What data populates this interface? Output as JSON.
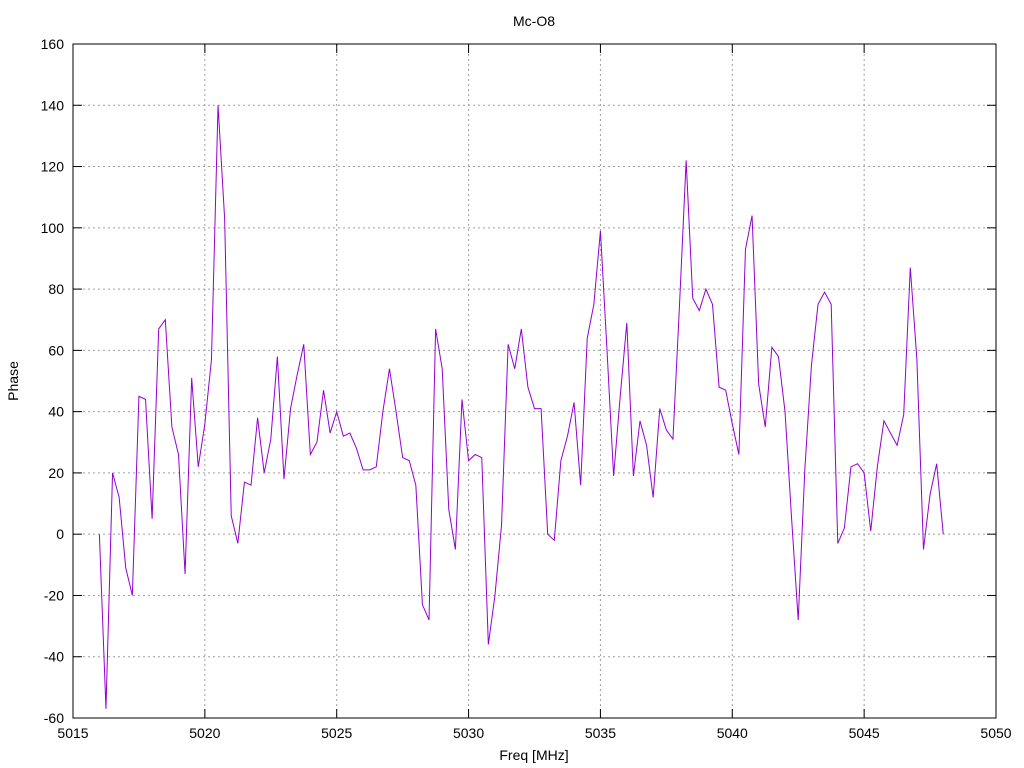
{
  "chart_data": {
    "type": "line",
    "title": "Mc-O8",
    "xlabel": "Freq [MHz]",
    "ylabel": "Phase",
    "xlim": [
      5015,
      5050
    ],
    "ylim": [
      -60,
      160
    ],
    "xticks": [
      5015,
      5020,
      5025,
      5030,
      5035,
      5040,
      5045,
      5050
    ],
    "yticks": [
      -60,
      -40,
      -20,
      0,
      20,
      40,
      60,
      80,
      100,
      120,
      140,
      160
    ],
    "grid": true,
    "series": [
      {
        "color": "#9400d3",
        "x": [
          5016.0,
          5016.25,
          5016.5,
          5016.75,
          5017.0,
          5017.25,
          5017.5,
          5017.75,
          5018.0,
          5018.25,
          5018.5,
          5018.75,
          5019.0,
          5019.25,
          5019.5,
          5019.75,
          5020.0,
          5020.25,
          5020.5,
          5020.75,
          5021.0,
          5021.25,
          5021.5,
          5021.75,
          5022.0,
          5022.25,
          5022.5,
          5022.75,
          5023.0,
          5023.25,
          5023.5,
          5023.75,
          5024.0,
          5024.25,
          5024.5,
          5024.75,
          5025.0,
          5025.25,
          5025.5,
          5025.75,
          5026.0,
          5026.25,
          5026.5,
          5026.75,
          5027.0,
          5027.25,
          5027.5,
          5027.75,
          5028.0,
          5028.25,
          5028.5,
          5028.75,
          5029.0,
          5029.25,
          5029.5,
          5029.75,
          5030.0,
          5030.25,
          5030.5,
          5030.75,
          5031.0,
          5031.25,
          5031.5,
          5031.75,
          5032.0,
          5032.25,
          5032.5,
          5032.75,
          5033.0,
          5033.25,
          5033.5,
          5033.75,
          5034.0,
          5034.25,
          5034.5,
          5034.75,
          5035.0,
          5035.25,
          5035.5,
          5035.75,
          5036.0,
          5036.25,
          5036.5,
          5036.75,
          5037.0,
          5037.25,
          5037.5,
          5037.75,
          5038.0,
          5038.25,
          5038.5,
          5038.75,
          5039.0,
          5039.25,
          5039.5,
          5039.75,
          5040.0,
          5040.25,
          5040.5,
          5040.75,
          5041.0,
          5041.25,
          5041.5,
          5041.75,
          5042.0,
          5042.25,
          5042.5,
          5042.75,
          5043.0,
          5043.25,
          5043.5,
          5043.75,
          5044.0,
          5044.25,
          5044.5,
          5044.75,
          5045.0,
          5045.25,
          5045.5,
          5045.75,
          5046.0,
          5046.25,
          5046.5,
          5046.75,
          5047.0,
          5047.25,
          5047.5,
          5047.75,
          5048.0
        ],
        "values": [
          0,
          -57,
          20,
          12,
          -11,
          -20,
          45,
          44,
          5,
          67,
          70,
          35,
          26,
          -13,
          51,
          22,
          36,
          57,
          140,
          103,
          6,
          -3,
          17,
          16,
          38,
          20,
          31,
          58,
          18,
          41,
          52,
          62,
          26,
          30,
          47,
          33,
          40,
          32,
          33,
          28,
          21,
          21,
          22,
          40,
          54,
          40,
          25,
          24,
          16,
          -23,
          -28,
          67,
          54,
          8,
          -5,
          44,
          24,
          26,
          25,
          -36,
          -20,
          3,
          62,
          54,
          67,
          48,
          41,
          41,
          0,
          -2,
          24,
          32,
          43,
          16,
          64,
          75,
          99,
          60,
          19,
          45,
          69,
          19,
          37,
          29,
          12,
          41,
          34,
          31,
          75,
          122,
          77,
          73,
          80,
          75,
          48,
          47,
          36,
          26,
          93,
          104,
          49,
          35,
          61,
          58,
          40,
          5,
          -28,
          21,
          55,
          75,
          79,
          75,
          -3,
          2,
          22,
          23,
          20,
          1,
          22,
          37,
          33,
          29,
          39,
          87,
          57,
          -5,
          13,
          23,
          0
        ]
      }
    ]
  }
}
